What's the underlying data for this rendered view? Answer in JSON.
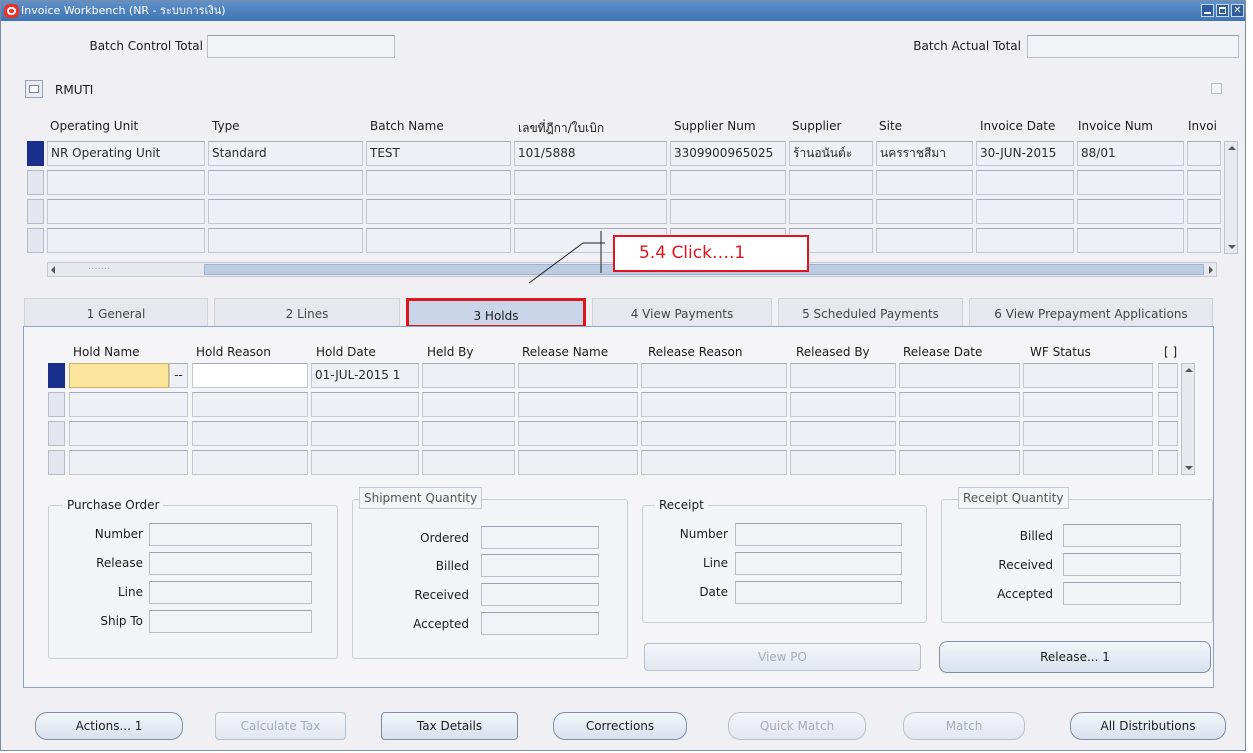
{
  "window": {
    "title": "Invoice Workbench (NR - ระบบการเงิน)"
  },
  "batch": {
    "control_total_label": "Batch Control Total",
    "control_total_value": "",
    "actual_total_label": "Batch Actual Total",
    "actual_total_value": ""
  },
  "org": {
    "name": "RMUTI"
  },
  "invoices": {
    "columns": [
      "Operating Unit",
      "Type",
      "Batch Name",
      "เลขที่ฎีกา/ใบเบิก",
      "Supplier Num",
      "Supplier",
      "Site",
      "Invoice Date",
      "Invoice Num",
      "Invoi"
    ],
    "rows": [
      [
        "NR Operating Unit",
        "Standard",
        "TEST",
        "101/5888",
        "3309900965025",
        "ร้านอนันต์ะ",
        "นครราชสีมา",
        "30-JUN-2015",
        "88/01",
        ""
      ],
      [
        "",
        "",
        "",
        "",
        "",
        "",
        "",
        "",
        "",
        ""
      ],
      [
        "",
        "",
        "",
        "",
        "",
        "",
        "",
        "",
        "",
        ""
      ],
      [
        "",
        "",
        "",
        "",
        "",
        "",
        "",
        "",
        "",
        ""
      ]
    ],
    "scroll_dots": "......."
  },
  "callout": {
    "text": "5.4 Click….1"
  },
  "tabs": [
    {
      "label": "1 General"
    },
    {
      "label": "2 Lines"
    },
    {
      "label": "3 Holds"
    },
    {
      "label": "4 View Payments"
    },
    {
      "label": "5 Scheduled Payments"
    },
    {
      "label": "6 View Prepayment Applications"
    }
  ],
  "holds": {
    "columns": [
      "Hold Name",
      "Hold Reason",
      "Hold Date",
      "Held By",
      "Release Name",
      "Release Reason",
      "Released By",
      "Release Date",
      "WF Status",
      "[ ]"
    ],
    "rows": [
      [
        "",
        "",
        "01-JUL-2015 1",
        "",
        "",
        "",
        "",
        "",
        "",
        ""
      ],
      [
        "",
        "",
        "",
        "",
        "",
        "",
        "",
        "",
        "",
        ""
      ],
      [
        "",
        "",
        "",
        "",
        "",
        "",
        "",
        "",
        "",
        ""
      ],
      [
        "",
        "",
        "",
        "",
        "",
        "",
        "",
        "",
        "",
        ""
      ]
    ],
    "lov_symbol": "--"
  },
  "purchase_order": {
    "title": "Purchase Order",
    "number_label": "Number",
    "release_label": "Release",
    "line_label": "Line",
    "ship_to_label": "Ship To"
  },
  "shipment_quantity": {
    "title": "Shipment Quantity",
    "ordered_label": "Ordered",
    "billed_label": "Billed",
    "received_label": "Received",
    "accepted_label": "Accepted"
  },
  "receipt": {
    "title": "Receipt",
    "number_label": "Number",
    "line_label": "Line",
    "date_label": "Date"
  },
  "receipt_quantity": {
    "title": "Receipt Quantity",
    "billed_label": "Billed",
    "received_label": "Received",
    "accepted_label": "Accepted"
  },
  "panel_buttons": {
    "view_po": "View PO",
    "release": "Release... 1"
  },
  "footer_buttons": {
    "actions": "Actions... 1",
    "calculate_tax": "Calculate Tax",
    "tax_details": "Tax Details",
    "corrections": "Corrections",
    "quick_match": "Quick Match",
    "match": "Match",
    "all_distributions": "All Distributions"
  },
  "colors": {
    "title_bar": "#3f74b3",
    "active_row": "#1a2e8c",
    "callout": "#e0161f",
    "active_tab": "#c9d6ea"
  }
}
